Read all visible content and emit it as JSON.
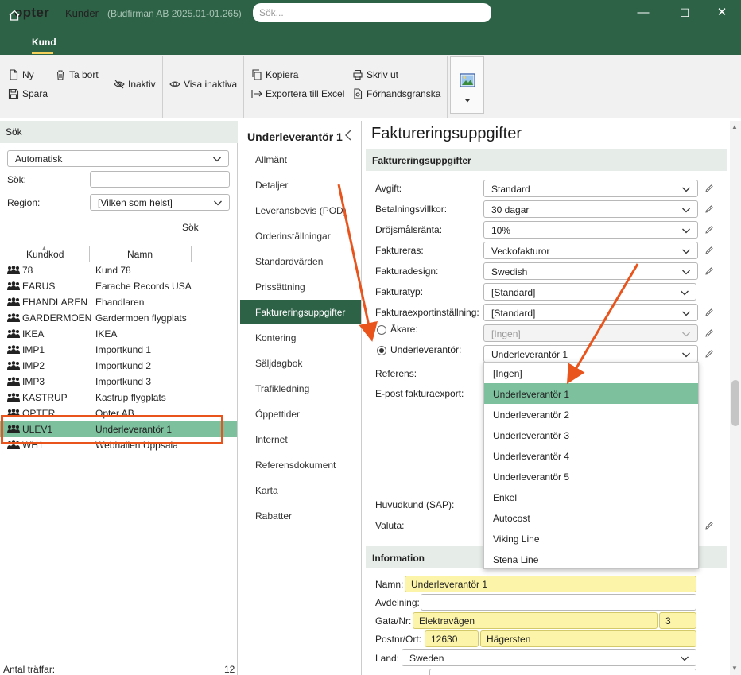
{
  "titlebar": {
    "logo": "opter",
    "title": "Kunder",
    "subtitle": "(Budfirman AB 2025.01-01.265)",
    "search_placeholder": "Sök...",
    "minimize": "—",
    "maximize": "☐",
    "close": "✕"
  },
  "tabbar": {
    "tab": "Kund"
  },
  "ribbon": {
    "new": "Ny",
    "delete": "Ta bort",
    "save": "Spara",
    "inactive": "Inaktiv",
    "show_inactive": "Visa inaktiva",
    "copy": "Kopiera",
    "export_excel": "Exportera till Excel",
    "print": "Skriv ut",
    "preview": "Förhandsgranska"
  },
  "search_panel": {
    "header": "Sök",
    "mode": "Automatisk",
    "search_label": "Sök:",
    "search_value": "",
    "region_label": "Region:",
    "region_value": "[Vilken som helst]",
    "search_button": "Sök",
    "columns": [
      "Kundkod",
      "Namn"
    ],
    "rows": [
      {
        "code": "78",
        "name": "Kund 78"
      },
      {
        "code": "EARUS",
        "name": "Earache Records USA"
      },
      {
        "code": "EHANDLAREN",
        "name": "Ehandlaren"
      },
      {
        "code": "GARDERMOEN",
        "name": "Gardermoen flygplats"
      },
      {
        "code": "IKEA",
        "name": "IKEA"
      },
      {
        "code": "IMP1",
        "name": "Importkund 1"
      },
      {
        "code": "IMP2",
        "name": "Importkund 2"
      },
      {
        "code": "IMP3",
        "name": "Importkund 3"
      },
      {
        "code": "KASTRUP",
        "name": "Kastrup flygplats"
      },
      {
        "code": "OPTER",
        "name": "Opter AB"
      },
      {
        "code": "ULEV1",
        "name": "Underleverantör 1"
      },
      {
        "code": "WH1",
        "name": "Webhallen Uppsala"
      }
    ],
    "selected_index": 10,
    "hits_label": "Antal träffar:",
    "hits_count": "12"
  },
  "nav": {
    "header": "Underleverantör 1",
    "items": [
      "Allmänt",
      "Detaljer",
      "Leveransbevis (POD)",
      "Orderinställningar",
      "Standardvärden",
      "Prissättning",
      "Faktureringsuppgifter",
      "Kontering",
      "Säljdagbok",
      "Trafikledning",
      "Öppettider",
      "Internet",
      "Referensdokument",
      "Karta",
      "Rabatter"
    ],
    "active_index": 6
  },
  "detail": {
    "title": "Faktureringsuppgifter",
    "section1": "Faktureringsuppgifter",
    "fields": [
      {
        "label": "Avgift:",
        "value": "Standard"
      },
      {
        "label": "Betalningsvillkor:",
        "value": "30 dagar"
      },
      {
        "label": "Dröjsmålsränta:",
        "value": "10%"
      },
      {
        "label": "Faktureras:",
        "value": "Veckofakturor"
      },
      {
        "label": "Fakturadesign:",
        "value": "Swedish"
      },
      {
        "label": "Fakturatyp:",
        "value": "[Standard]"
      },
      {
        "label": "Fakturaexportinställning:",
        "value": "[Standard]"
      }
    ],
    "akare_label": "Åkare:",
    "akare_value": "[Ingen]",
    "underlev_label": "Underleverantör:",
    "underlev_value": "Underleverantör 1",
    "referens_label": "Referens:",
    "epost_label": "E-post fakturaexport:",
    "huvudkund_label": "Huvudkund (SAP):",
    "valuta_label": "Valuta:",
    "dropdown_options": [
      "[Ingen]",
      "Underleverantör 1",
      "Underleverantör 2",
      "Underleverantör 3",
      "Underleverantör 4",
      "Underleverantör 5",
      "Enkel",
      "Autocost",
      "Viking Line",
      "Stena Line"
    ],
    "dropdown_highlight": 1,
    "section2": "Information",
    "namn_label": "Namn:",
    "namn_value": "Underleverantör 1",
    "avdelning_label": "Avdelning:",
    "gata_label": "Gata/Nr:",
    "gata_value": "Elektravägen",
    "gata_nr": "3",
    "postnr_label": "Postnr/Ort:",
    "postnr_value": "12630",
    "ort_value": "Hägersten",
    "land_label": "Land:",
    "land_value": "Sweden"
  },
  "colors": {
    "brand_green": "#2e6247",
    "selection_green": "#7cc09d",
    "annotation_orange": "#e8541c",
    "required_yellow": "#fcf4a8"
  }
}
